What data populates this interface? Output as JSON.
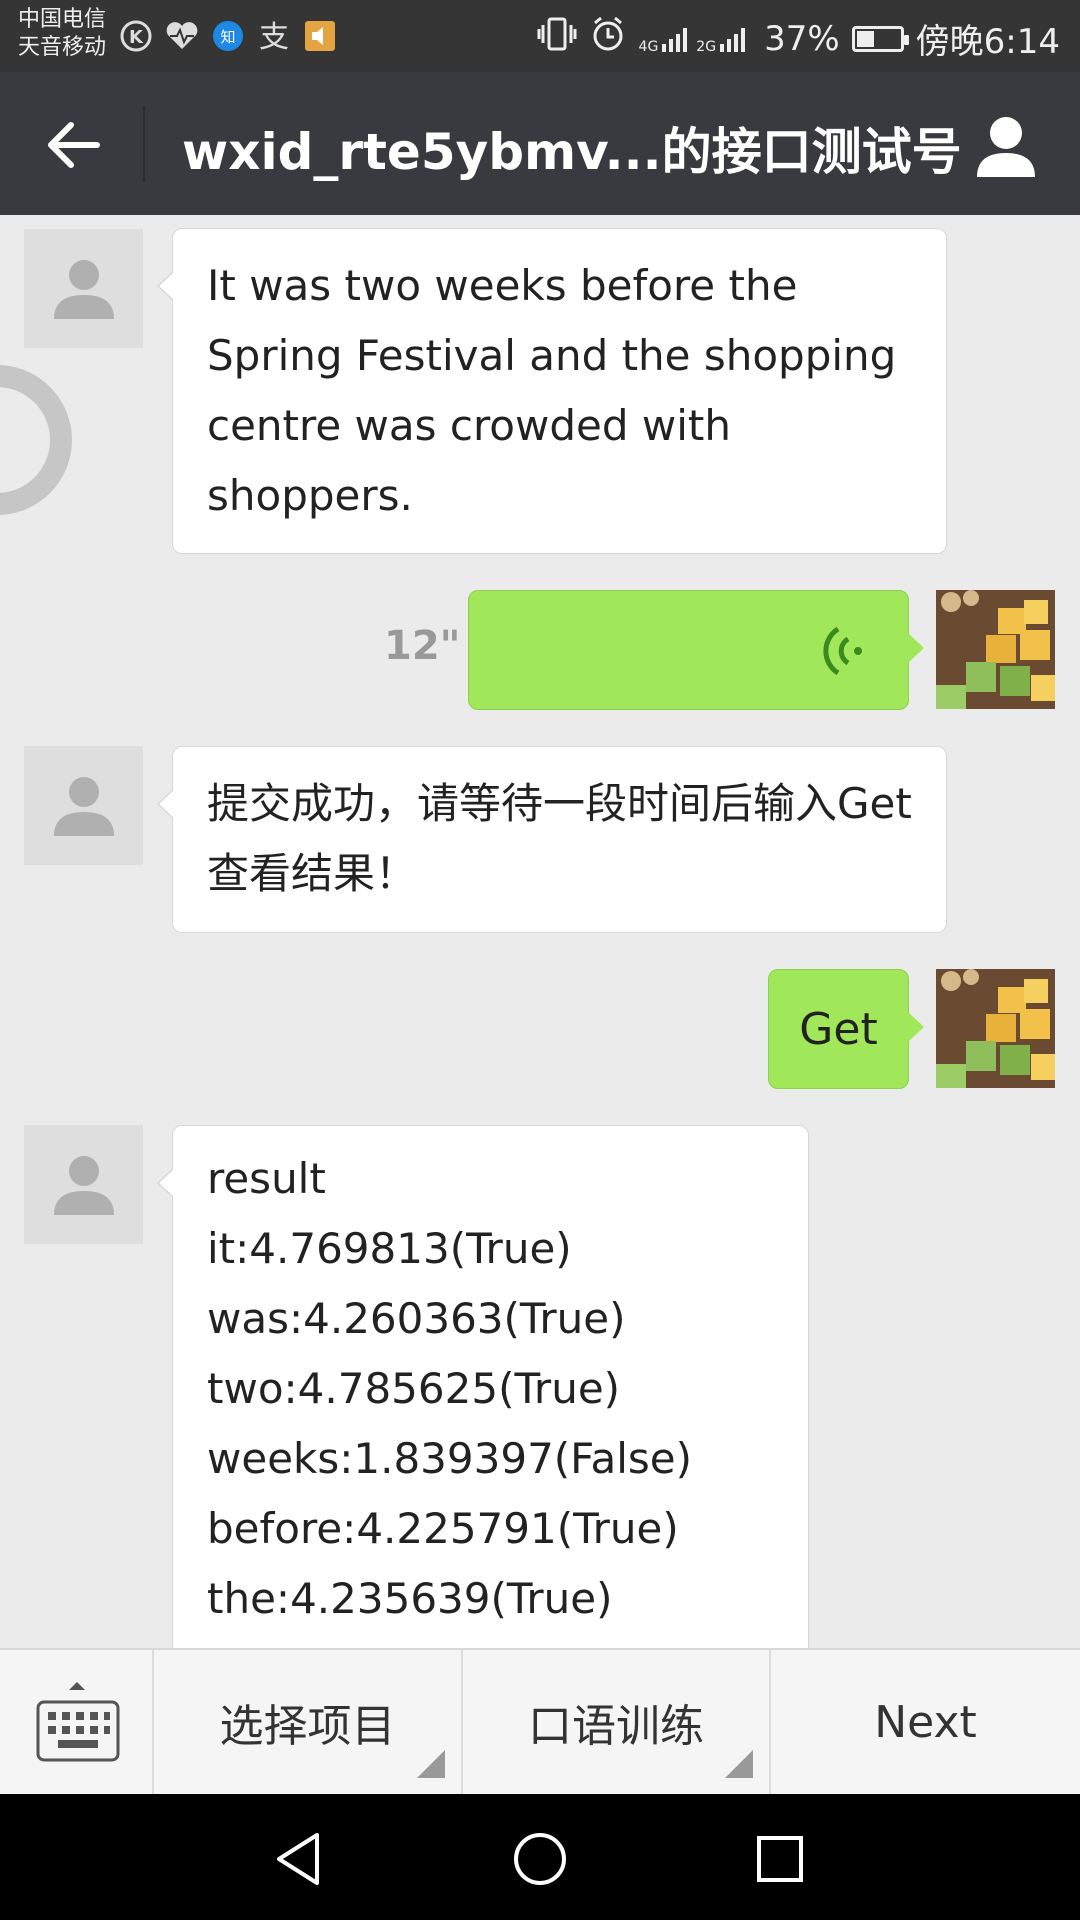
{
  "status_bar": {
    "carrier_line1": "中国电信",
    "carrier_line2": "天音移动",
    "network1": "4G",
    "network2": "2G",
    "battery": "37%",
    "battery_level": 0.37,
    "time": "傍晚6:14",
    "icons": [
      "k-icon",
      "heart-rate-icon",
      "zhihu-icon",
      "alipay-icon",
      "speaker-app-icon",
      "vibrate-icon",
      "alarm-icon",
      "signal-icon",
      "battery-icon"
    ]
  },
  "header": {
    "title": "wxid_rte5ybmv...的接口测试号",
    "back_icon": "arrow-left-icon",
    "profile_icon": "person-icon"
  },
  "messages": [
    {
      "side": "left",
      "text": "It was two weeks before the Spring Festival and the shopping centre was crowded with shoppers."
    },
    {
      "side": "right",
      "type": "voice",
      "duration": "12\""
    },
    {
      "side": "left",
      "text": "提交成功，请等待一段时间后输入Get 查看结果！"
    },
    {
      "side": "right",
      "text": "Get"
    },
    {
      "side": "left",
      "lines": [
        "result",
        "it:4.769813(True)",
        "was:4.260363(True)",
        "two:4.785625(True)",
        "weeks:1.839397(False)",
        "before:4.225791(True)",
        "the:4.235639(True)"
      ]
    }
  ],
  "menu": {
    "keyboard_icon": "keyboard-icon",
    "items": [
      {
        "label": "选择项目"
      },
      {
        "label": "口语训练"
      },
      {
        "label": "Next"
      }
    ]
  },
  "nav": {
    "icons": [
      "back-triangle-icon",
      "home-circle-icon",
      "recents-square-icon"
    ]
  },
  "colors": {
    "header_bg": "#393a3f",
    "my_bubble": "#a0e75a",
    "chat_bg": "#ebebeb"
  }
}
